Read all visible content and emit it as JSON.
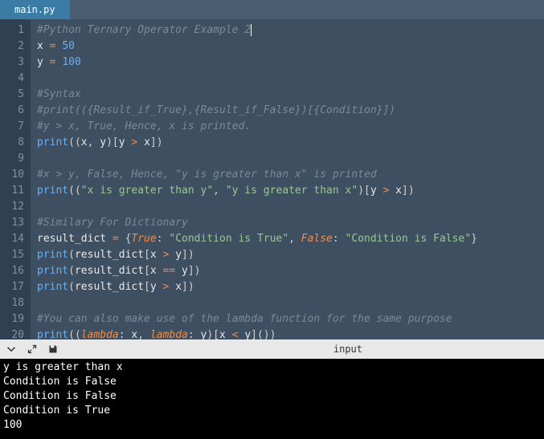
{
  "tab": {
    "name": "main.py"
  },
  "lines": [
    {
      "n": 1,
      "tokens": [
        [
          "c-comment",
          "#Python Ternary Operator Example 2"
        ]
      ],
      "cursor": true
    },
    {
      "n": 2,
      "tokens": [
        [
          "c-ident",
          "x "
        ],
        [
          "c-op",
          "="
        ],
        [
          "c-ident",
          " "
        ],
        [
          "c-num",
          "50"
        ]
      ]
    },
    {
      "n": 3,
      "tokens": [
        [
          "c-ident",
          "y "
        ],
        [
          "c-op",
          "="
        ],
        [
          "c-ident",
          " "
        ],
        [
          "c-num",
          "100"
        ]
      ]
    },
    {
      "n": 4,
      "tokens": []
    },
    {
      "n": 5,
      "tokens": [
        [
          "c-comment",
          "#Syntax"
        ]
      ]
    },
    {
      "n": 6,
      "tokens": [
        [
          "c-comment",
          "#print(({Result_if_True},{Result_if_False})[{Condition}])"
        ]
      ]
    },
    {
      "n": 7,
      "tokens": [
        [
          "c-comment",
          "#y > x, True, Hence, x is printed."
        ]
      ]
    },
    {
      "n": 8,
      "tokens": [
        [
          "c-func",
          "print"
        ],
        [
          "c-paren",
          "(("
        ],
        [
          "c-ident",
          "x"
        ],
        [
          "c-paren",
          ", "
        ],
        [
          "c-ident",
          "y"
        ],
        [
          "c-paren",
          ")["
        ],
        [
          "c-ident",
          "y "
        ],
        [
          "c-op",
          ">"
        ],
        [
          "c-ident",
          " x"
        ],
        [
          "c-paren",
          "])"
        ]
      ]
    },
    {
      "n": 9,
      "tokens": []
    },
    {
      "n": 10,
      "tokens": [
        [
          "c-comment",
          "#x > y, False, Hence, \"y is greater than x\" is printed"
        ]
      ]
    },
    {
      "n": 11,
      "tokens": [
        [
          "c-func",
          "print"
        ],
        [
          "c-paren",
          "(("
        ],
        [
          "c-str",
          "\"x is greater than y\""
        ],
        [
          "c-paren",
          ", "
        ],
        [
          "c-str",
          "\"y is greater than x\""
        ],
        [
          "c-paren",
          ")["
        ],
        [
          "c-ident",
          "y "
        ],
        [
          "c-op",
          ">"
        ],
        [
          "c-ident",
          " x"
        ],
        [
          "c-paren",
          "])"
        ]
      ]
    },
    {
      "n": 12,
      "tokens": []
    },
    {
      "n": 13,
      "tokens": [
        [
          "c-comment",
          "#Similary For Dictionary"
        ]
      ]
    },
    {
      "n": 14,
      "tokens": [
        [
          "c-ident",
          "result_dict "
        ],
        [
          "c-op",
          "="
        ],
        [
          "c-ident",
          " "
        ],
        [
          "c-paren",
          "{"
        ],
        [
          "c-const",
          "True"
        ],
        [
          "c-paren",
          ": "
        ],
        [
          "c-str",
          "\"Condition is True\""
        ],
        [
          "c-paren",
          ", "
        ],
        [
          "c-const",
          "False"
        ],
        [
          "c-paren",
          ": "
        ],
        [
          "c-str",
          "\"Condition is False\""
        ],
        [
          "c-paren",
          "}"
        ]
      ]
    },
    {
      "n": 15,
      "tokens": [
        [
          "c-func",
          "print"
        ],
        [
          "c-paren",
          "("
        ],
        [
          "c-ident",
          "result_dict"
        ],
        [
          "c-paren",
          "["
        ],
        [
          "c-ident",
          "x "
        ],
        [
          "c-op",
          ">"
        ],
        [
          "c-ident",
          " y"
        ],
        [
          "c-paren",
          "])"
        ]
      ]
    },
    {
      "n": 16,
      "tokens": [
        [
          "c-func",
          "print"
        ],
        [
          "c-paren",
          "("
        ],
        [
          "c-ident",
          "result_dict"
        ],
        [
          "c-paren",
          "["
        ],
        [
          "c-ident",
          "x "
        ],
        [
          "c-op",
          "=="
        ],
        [
          "c-ident",
          " y"
        ],
        [
          "c-paren",
          "])"
        ]
      ]
    },
    {
      "n": 17,
      "tokens": [
        [
          "c-func",
          "print"
        ],
        [
          "c-paren",
          "("
        ],
        [
          "c-ident",
          "result_dict"
        ],
        [
          "c-paren",
          "["
        ],
        [
          "c-ident",
          "y "
        ],
        [
          "c-op",
          ">"
        ],
        [
          "c-ident",
          " x"
        ],
        [
          "c-paren",
          "])"
        ]
      ]
    },
    {
      "n": 18,
      "tokens": []
    },
    {
      "n": 19,
      "tokens": [
        [
          "c-comment",
          "#You can also make use of the lambda function for the same purpose"
        ]
      ]
    },
    {
      "n": 20,
      "tokens": [
        [
          "c-func",
          "print"
        ],
        [
          "c-paren",
          "(("
        ],
        [
          "c-kw",
          "lambda"
        ],
        [
          "c-paren",
          ": "
        ],
        [
          "c-ident",
          "x"
        ],
        [
          "c-paren",
          ", "
        ],
        [
          "c-kw",
          "lambda"
        ],
        [
          "c-paren",
          ": "
        ],
        [
          "c-ident",
          "y"
        ],
        [
          "c-paren",
          ")["
        ],
        [
          "c-ident",
          "x "
        ],
        [
          "c-op",
          "<"
        ],
        [
          "c-ident",
          " y"
        ],
        [
          "c-paren",
          "]())"
        ]
      ]
    }
  ],
  "console_bar": {
    "input_label": "input"
  },
  "output": [
    "y is greater than x",
    "Condition is False",
    "Condition is False",
    "Condition is True",
    "100"
  ]
}
